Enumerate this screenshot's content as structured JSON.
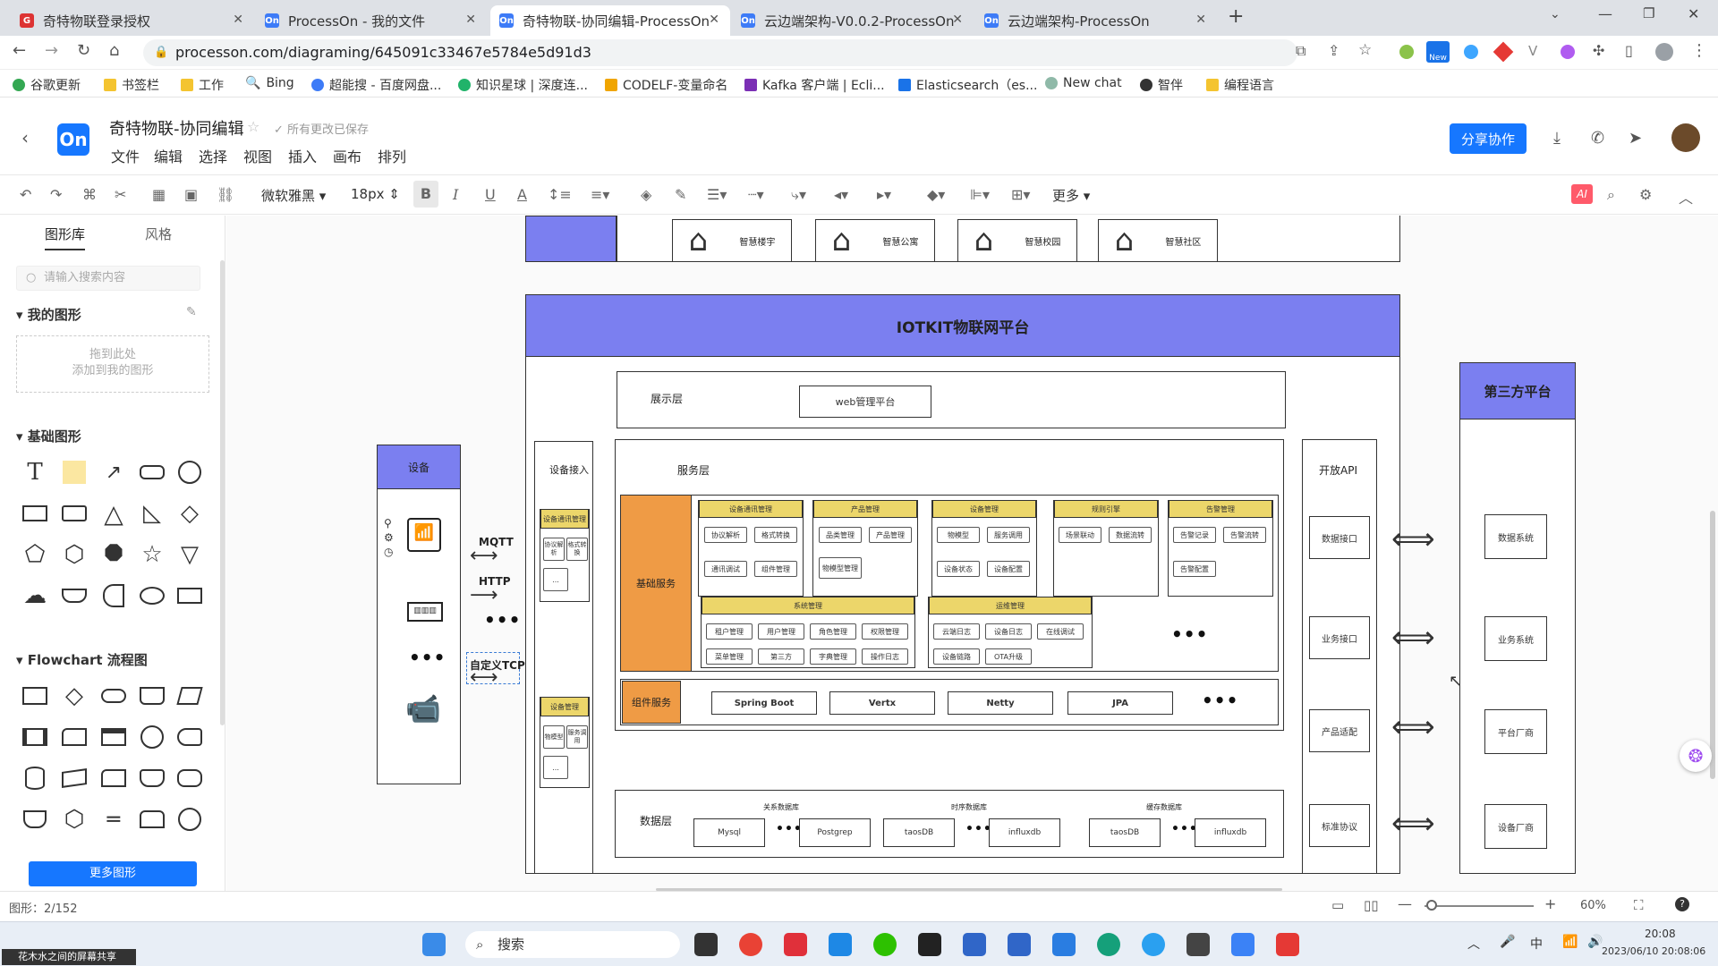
{
  "browser": {
    "tabs": [
      {
        "label": "奇特物联登录授权",
        "fav": "G"
      },
      {
        "label": "ProcessOn - 我的文件",
        "fav": "On"
      },
      {
        "label": "奇特物联-协同编辑-ProcessOn",
        "fav": "On"
      },
      {
        "label": "云边端架构-V0.0.2-ProcessOn",
        "fav": "On"
      },
      {
        "label": "云边端架构-ProcessOn",
        "fav": "On"
      }
    ],
    "new_tab": "+",
    "url": "processon.com/diagraming/645091c33467e5784e5d91d3",
    "new_badge": "New",
    "bookmarks": [
      "谷歌更新",
      "书签栏",
      "工作",
      "Bing",
      "超能搜 - 百度网盘...",
      "知识星球 | 深度连...",
      "CODELF-变量命名",
      "Kafka 客户端 | Ecli...",
      "Elasticsearch（es...",
      "New chat",
      "智伴",
      "编程语言"
    ]
  },
  "app": {
    "logo": "On",
    "title": "奇特物联-协同编辑",
    "saved": "所有更改已保存",
    "menus": [
      "文件",
      "编辑",
      "选择",
      "视图",
      "插入",
      "画布",
      "排列"
    ],
    "share": "分享协作",
    "toolbar": {
      "font": "微软雅黑",
      "size": "18px",
      "bold": "B",
      "italic": "I",
      "underline": "U",
      "color": "A",
      "more": "更多"
    }
  },
  "sidebar": {
    "tabs": [
      "图形库",
      "风格"
    ],
    "search_placeholder": "请输入搜索内容",
    "my_shapes": "我的图形",
    "drop_hint_1": "拖到此处",
    "drop_hint_2": "添加到我的图形",
    "basic": "基础图形",
    "flowchart": "Flowchart 流程图",
    "more": "更多图形"
  },
  "diagram": {
    "top_items": [
      "智慧楼宇",
      "智慧公寓",
      "智慧校园",
      "智慧社区"
    ],
    "platform": "IOTKIT物联网平台",
    "display_layer": "展示层",
    "web": "web管理平台",
    "device": "设备",
    "protocols": [
      "MQTT",
      "HTTP",
      "自定义TCP"
    ],
    "access": "设备接入",
    "access_groups": [
      {
        "title": "设备通讯管理",
        "items": [
          "协议解析",
          "格式转换"
        ]
      },
      {
        "title": "设备管理",
        "items": [
          "物模型",
          "服务调用"
        ]
      }
    ],
    "service_layer": "服务层",
    "base_service": "基础服务",
    "modules": [
      {
        "title": "设备通讯管理",
        "items": [
          "协议解析",
          "格式转换",
          "通讯调试",
          "组件管理"
        ]
      },
      {
        "title": "产品管理",
        "items": [
          "品类管理",
          "产品管理",
          "物模型管理"
        ]
      },
      {
        "title": "设备管理",
        "items": [
          "物模型",
          "服务调用",
          "设备状态",
          "设备配置"
        ]
      },
      {
        "title": "规则引擎",
        "items": [
          "场景联动",
          "数据流转"
        ]
      },
      {
        "title": "告警管理",
        "items": [
          "告警记录",
          "告警流转",
          "告警配置"
        ]
      },
      {
        "title": "系统管理",
        "items": [
          "租户管理",
          "用户管理",
          "角色管理",
          "权限管理",
          "菜单管理",
          "第三方",
          "字典管理",
          "操作日志"
        ]
      },
      {
        "title": "运维管理",
        "items": [
          "云端日志",
          "设备日志",
          "在线调试",
          "设备链路",
          "OTA升级"
        ]
      }
    ],
    "component_service": "组件服务",
    "components": [
      "Spring Boot",
      "Vertx",
      "Netty",
      "JPA"
    ],
    "data_layer": "数据层",
    "db_groups": [
      {
        "title": "关系数据库",
        "items": [
          "Mysql",
          "Postgrep"
        ]
      },
      {
        "title": "时序数据库",
        "items": [
          "taosDB",
          "influxdb"
        ]
      },
      {
        "title": "缓存数据库",
        "items": [
          "taosDB",
          "influxdb"
        ]
      }
    ],
    "api": "开放API",
    "api_items": [
      "数据接口",
      "业务接口",
      "产品适配",
      "标准协议"
    ],
    "third_party": "第三方平台",
    "third_items": [
      "数据系统",
      "业务系统",
      "平台厂商",
      "设备厂商"
    ],
    "ellipsis": "•••",
    "small_ellipsis": "..."
  },
  "status": {
    "shapes": "图形：2/152",
    "zoom": "60%"
  },
  "taskbar": {
    "search": "搜索",
    "time": "20:08",
    "date": "2023/06/10 20:08:06",
    "ime": "中",
    "share_note": "花木水之间的屏幕共享"
  }
}
